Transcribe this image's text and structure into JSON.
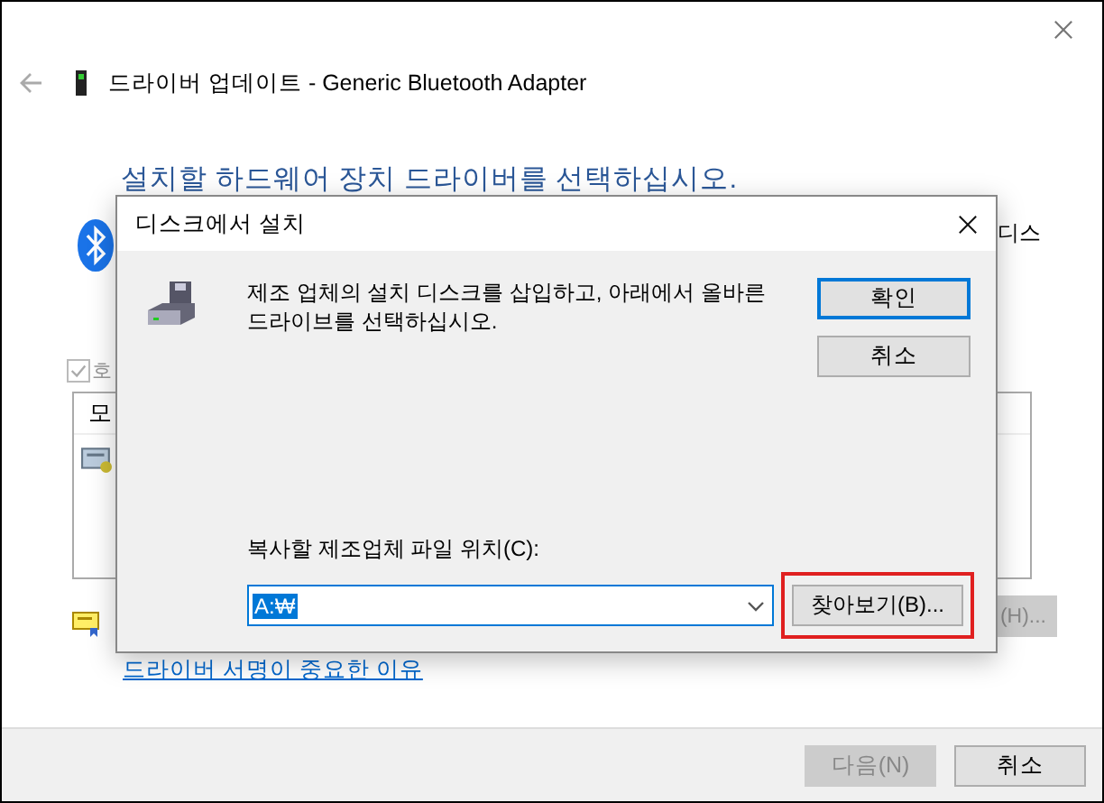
{
  "window": {
    "title": "드라이버 업데이트 - Generic Bluetooth Adapter",
    "heading": "설치할 하드웨어 장치 드라이버를 선택하십시오.",
    "side_text": "디스",
    "checkbox": {
      "label": "호",
      "checked": true,
      "disabled": true
    },
    "list": {
      "column_1": "모"
    },
    "partial_button": {
      "label": "(H)...",
      "disabled": true
    },
    "link": "드라이버 서명이 중요한 이유",
    "buttons": [
      {
        "label": "다음(N)",
        "disabled": true
      },
      {
        "label": "취소",
        "disabled": false
      }
    ]
  },
  "dialog": {
    "title": "디스크에서 설치",
    "message": "제조 업체의 설치 디스크를 삽입하고, 아래에서 올바른 드라이브를 선택하십시오.",
    "buttons": [
      {
        "label": "확인",
        "default": true
      },
      {
        "label": "취소",
        "default": false
      }
    ],
    "field": {
      "label": "복사할 제조업체 파일 위치(C):",
      "value": "A:₩",
      "selected": true
    },
    "browse": {
      "label": "찾아보기(B)...",
      "highlighted": true
    }
  }
}
